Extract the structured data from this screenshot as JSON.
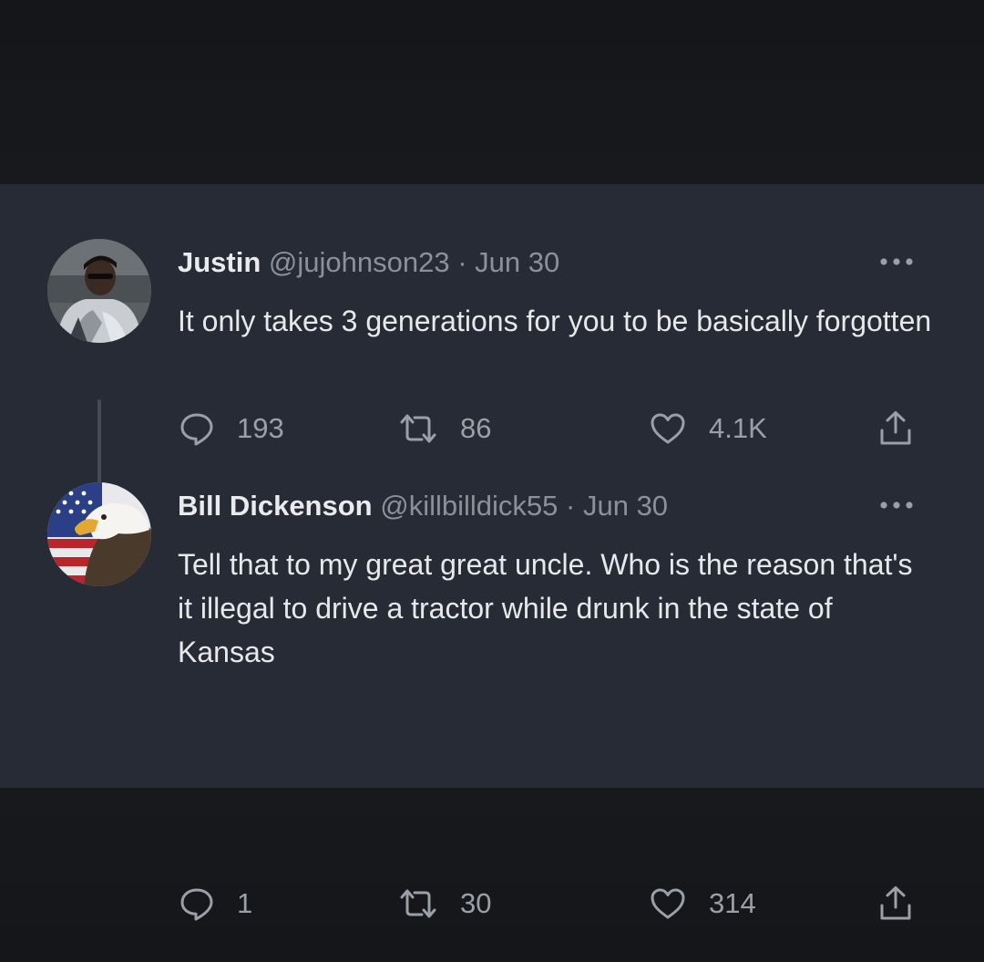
{
  "colors": {
    "card_background": "#272b36",
    "outer_background": "#17191d",
    "primary_text": "#e6e8eb",
    "secondary_text": "#8b9199",
    "thread_line": "#454a55"
  },
  "tweets": [
    {
      "avatar_icon": "profile-photo-person",
      "display_name": "Justin",
      "handle": "@jujohnson23",
      "separator": "·",
      "date": "Jun 30",
      "text": "It only takes 3 generations for you to be basically forgotten",
      "more_icon": "ellipsis-icon",
      "replies": "193",
      "retweets": "86",
      "likes": "4.1K",
      "share_icon": "share-icon"
    },
    {
      "avatar_icon": "profile-photo-eagle-flag",
      "display_name": "Bill Dickenson",
      "handle": "@killbilldick55",
      "separator": "·",
      "date": "Jun 30",
      "text": "Tell that to my great great uncle. Who is the reason that's it illegal to drive a tractor while drunk in the state of Kansas",
      "more_icon": "ellipsis-icon",
      "replies": "1",
      "retweets": "30",
      "likes": "314",
      "share_icon": "share-icon"
    }
  ]
}
